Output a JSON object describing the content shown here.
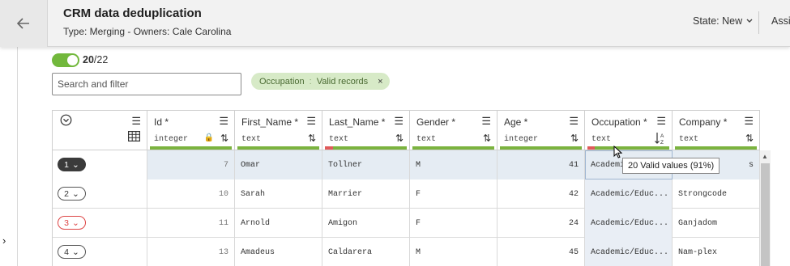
{
  "header": {
    "title": "CRM data deduplication",
    "subtitle": "Type: Merging - Owners: Cale Carolina",
    "state_label": "State: New",
    "assignee_label": "Assi"
  },
  "toolbar": {
    "toggle_on": true,
    "count_selected": "20",
    "count_total": "/22",
    "search_placeholder": "Search and filter",
    "filter_chip": {
      "field": "Occupation",
      "separator": ":",
      "value": "Valid records",
      "close": "×"
    }
  },
  "columns": [
    {
      "name": "Id *",
      "type": "integer",
      "locked": true,
      "invalid_fraction": 0
    },
    {
      "name": "First_Name *",
      "type": "text",
      "invalid_fraction": 0
    },
    {
      "name": "Last_Name *",
      "type": "text",
      "invalid_fraction": 0.1
    },
    {
      "name": "Gender *",
      "type": "text",
      "invalid_fraction": 0
    },
    {
      "name": "Age *",
      "type": "integer",
      "invalid_fraction": 0
    },
    {
      "name": "Occupation *",
      "type": "text",
      "invalid_fraction": 0.09
    },
    {
      "name": "Company *",
      "type": "text",
      "invalid_fraction": 0
    }
  ],
  "rows": [
    {
      "group": "1",
      "style": "dark",
      "selected": true,
      "id": "7",
      "first": "Omar",
      "last": "Tollner",
      "gender": "M",
      "age": "41",
      "occupation": "Academic",
      "company": "s"
    },
    {
      "group": "2",
      "style": "normal",
      "selected": false,
      "id": "10",
      "first": "Sarah",
      "last": "Marrier",
      "gender": "F",
      "age": "42",
      "occupation": "Academic/Educ...",
      "company": "Strongcode"
    },
    {
      "group": "3",
      "style": "red",
      "selected": false,
      "id": "11",
      "first": "Arnold",
      "last": "Amigon",
      "gender": "F",
      "age": "24",
      "occupation": "Academic/Educ...",
      "company": "Ganjadom"
    },
    {
      "group": "4",
      "style": "normal",
      "selected": false,
      "id": "13",
      "first": "Amadeus",
      "last": "Caldarera",
      "gender": "M",
      "age": "45",
      "occupation": "Academic/Educ...",
      "company": "Nam-plex"
    }
  ],
  "tooltip": "20 Valid values (91%)",
  "icons": {
    "back": "arrow-left-icon",
    "menu": "hamburger-icon",
    "sort": "sort-arrows-icon",
    "lock": "lock-icon",
    "chevron": "chevron-down-icon"
  },
  "colors": {
    "valid": "#7bb33f",
    "invalid": "#e05a5a",
    "toggle": "#72b83c",
    "chip_bg": "#d7eac7"
  }
}
